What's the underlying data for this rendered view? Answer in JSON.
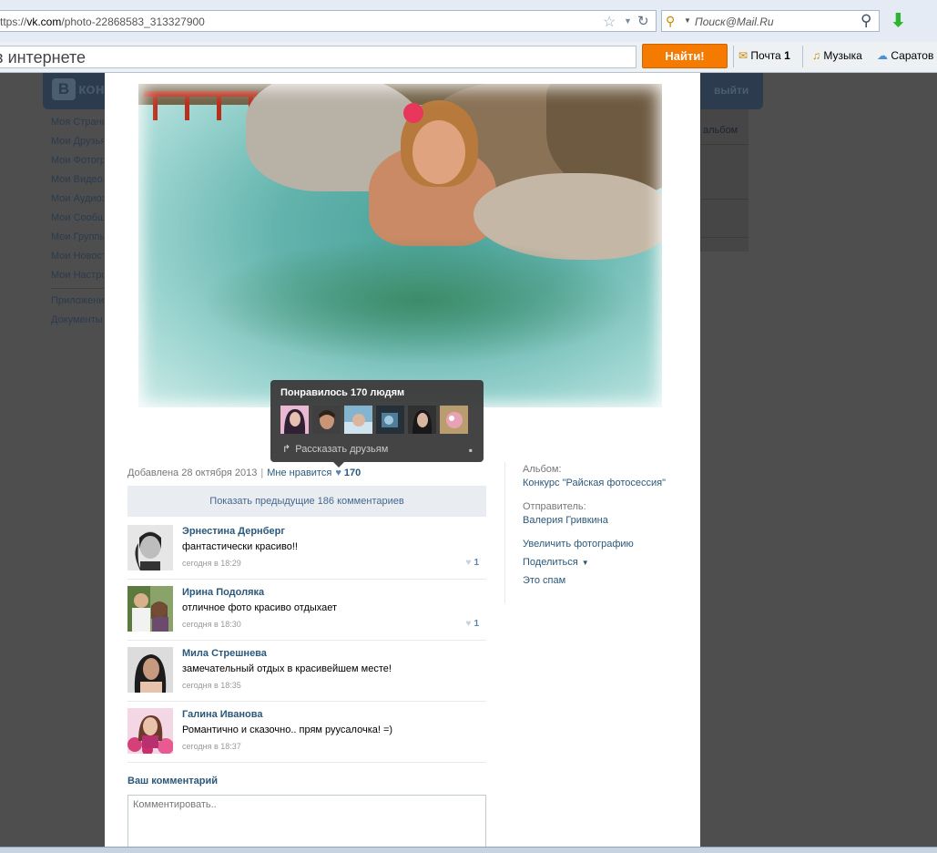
{
  "browser": {
    "url_prefix": "ttps://",
    "url_domain": "vk.com",
    "url_path": "/photo-22868583_313327900",
    "search_placeholder": "Поиск@Mail.Ru",
    "web_search_text": "в интернете",
    "find_button": "Найти!",
    "toolbar": {
      "mail_label": "Почта",
      "mail_count": "1",
      "music_label": "Музыка",
      "city_label": "Саратов"
    }
  },
  "vk": {
    "logo_letter": "B",
    "site_name": "кон",
    "exit_label": "выйти",
    "menu": [
      "Моя Страница",
      "Мои Друзья",
      "Мои Фотографии",
      "Мои Видеозаписи",
      "Мои Аудиозаписи",
      "Мои Сообщения",
      "Мои Группы",
      "Мои Новости",
      "Мои Настройки"
    ],
    "menu2": [
      "Приложения",
      "Документы"
    ],
    "right_label": "альбом"
  },
  "photo": {
    "added": "Добавлена 28 октября 2013",
    "separator": "|",
    "like_link": "Мне нравится",
    "like_count": "170",
    "show_prev": "Показать предыдущие 186 комментариев"
  },
  "tooltip": {
    "title": "Понравилось 170 людям",
    "share": "Рассказать друзьям"
  },
  "comments": [
    {
      "name": "Эрнестина Дернберг",
      "text": "фантастически красиво!!",
      "time": "сегодня в 18:29",
      "likes": "1"
    },
    {
      "name": "Ирина Подоляка",
      "text": "отличное фото красиво отдыхает",
      "time": "сегодня в 18:30",
      "likes": "1"
    },
    {
      "name": "Мила Стрешнева",
      "text": "замечательный отдых в красивейшем месте!",
      "time": "сегодня в 18:35",
      "likes": ""
    },
    {
      "name": "Галина Иванова",
      "text": "Романтично и сказочно.. прям руусалочка! =)",
      "time": "сегодня в 18:37",
      "likes": ""
    }
  ],
  "compose": {
    "label": "Ваш комментарий",
    "placeholder": "Комментировать.."
  },
  "sidebar": {
    "album_label": "Альбом:",
    "album_name": "Конкурс \"Райская фотосессия\"",
    "sender_label": "Отправитель:",
    "sender_name": "Валерия Гривкина",
    "enlarge": "Увеличить фотографию",
    "share": "Поделиться",
    "spam": "Это спам"
  },
  "colors": {
    "vk_link": "#2b587a",
    "find_orange": "#f47a00",
    "tooltip_bg": "#3e3e3e"
  }
}
